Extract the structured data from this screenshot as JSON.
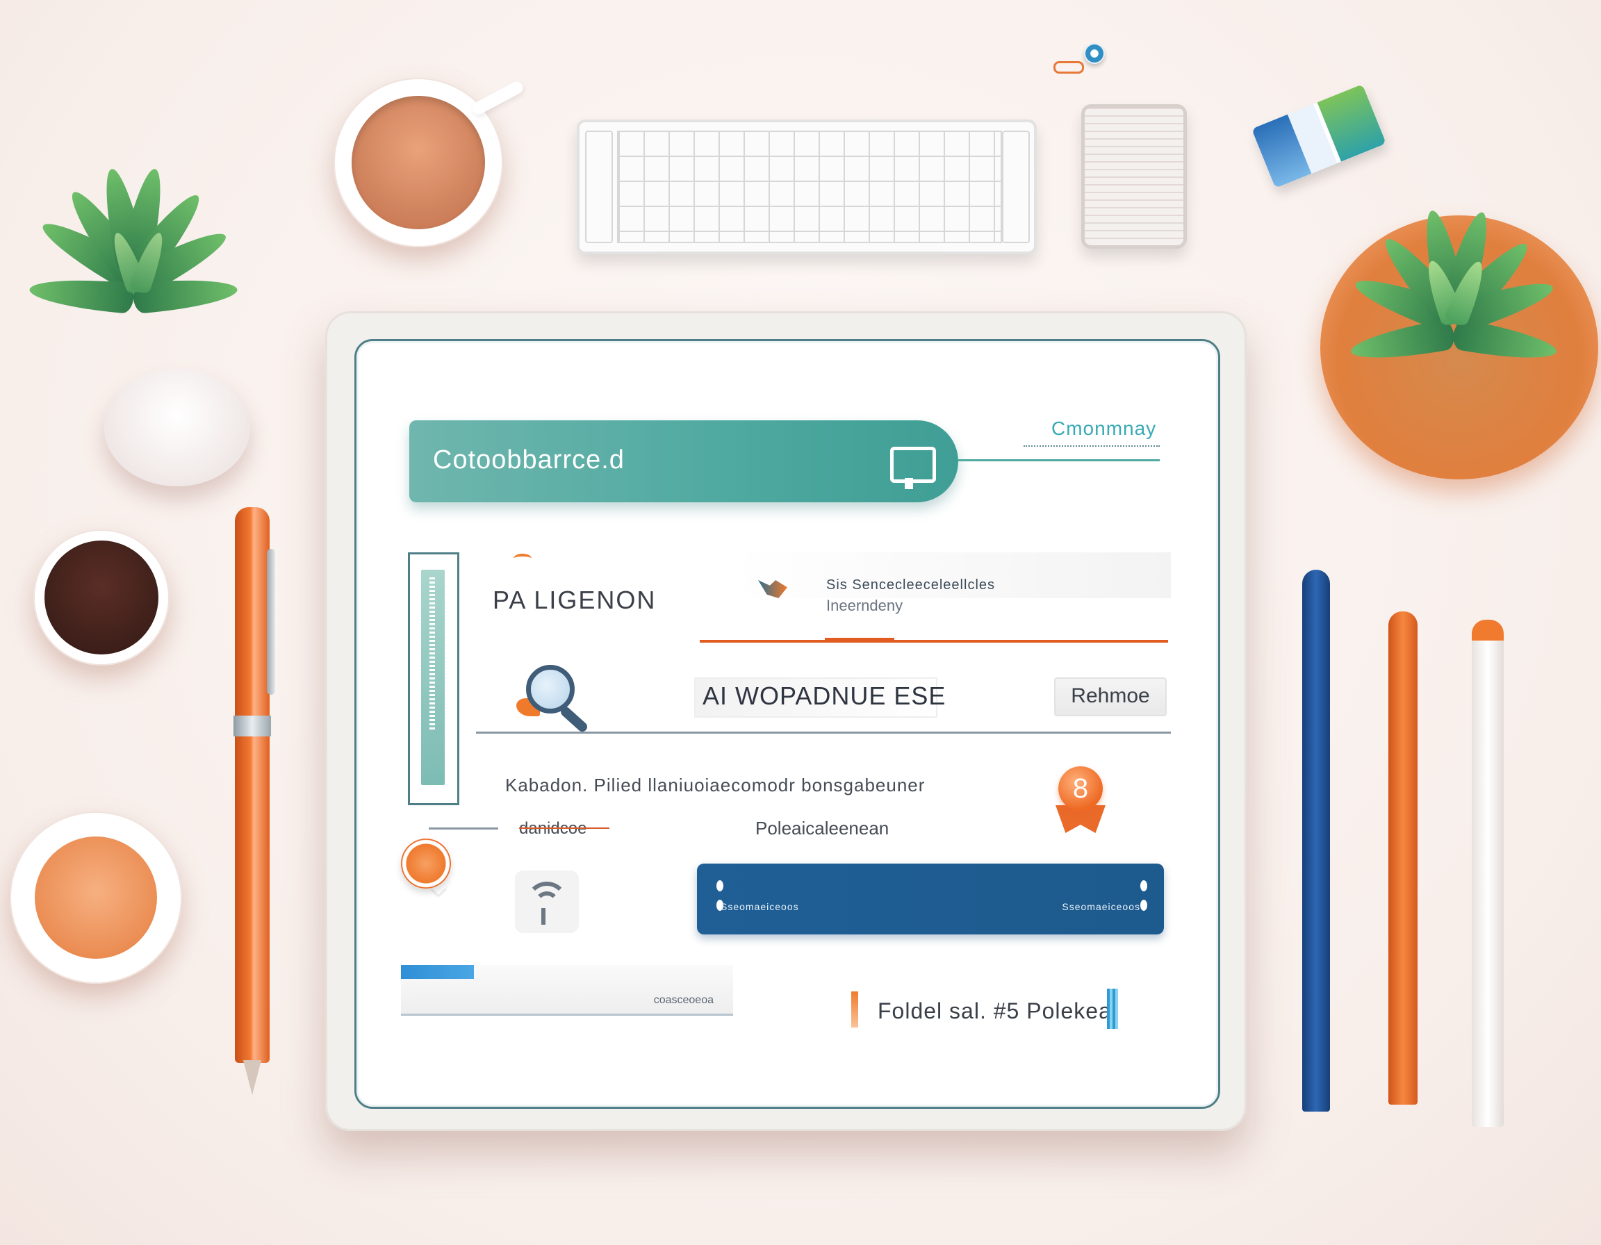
{
  "app": {
    "search_bar_text": "Cotoobbarrce.d",
    "top_link": "Cmonmnay",
    "section_title": "PA LIGENON",
    "info_line_1": "Sis  Sencecleeceleellcles",
    "info_line_2": "Ineerndeny",
    "field_text": "AI WOPADNUE ESE",
    "small_button_label": "Rehmoe",
    "paragraph_line_1": "Kabadon. Pilied llaniuoiaecomodr bonsgabeuner",
    "paragraph_line_2": "danidcoe",
    "paragraph_line_3": "Poleaicaleenean",
    "blue_bar_left_text": "Sseomaeiceoos",
    "blue_bar_right_text": "Sseomaeiceoos",
    "progress_text": "coasceoeoa",
    "progress_fraction": 0.22,
    "footer_text": "Foldel sal.  #5  Polekeal",
    "badge_glyph": "8"
  },
  "icons": {
    "search_bar_icon": "laptop-icon",
    "magnifier": "search-icon",
    "badge": "award-icon",
    "pin": "location-pin-icon",
    "wifi": "wifi-icon"
  },
  "colors": {
    "teal": "#4ea9a0",
    "blue": "#1f5f96",
    "orange": "#ef7a2e",
    "accent_cyan": "#39a9b5"
  }
}
